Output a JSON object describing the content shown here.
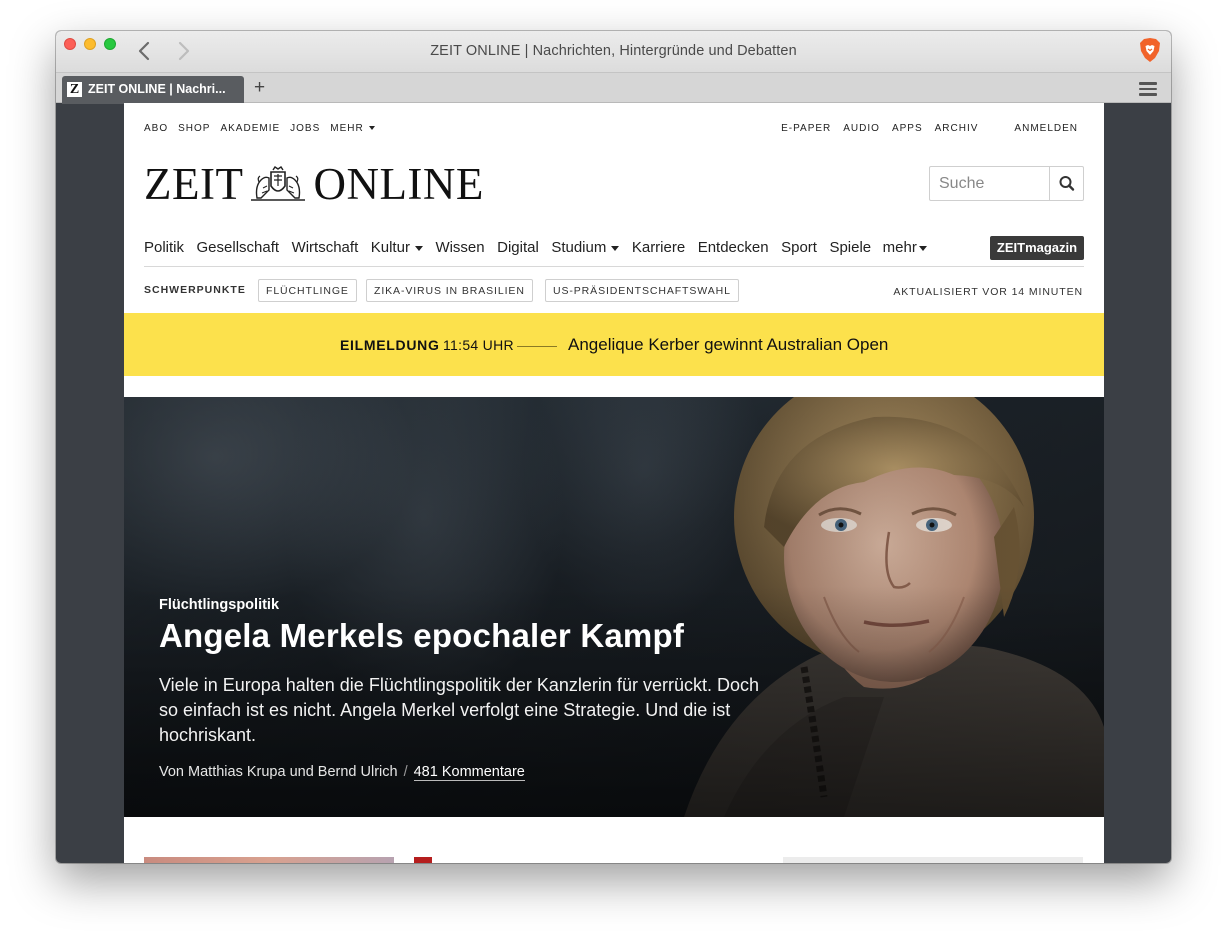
{
  "browser": {
    "window_title": "ZEIT ONLINE | Nachrichten, Hintergründe und Debatten",
    "tab_title": "ZEIT ONLINE | Nachri...",
    "new_tab": "+",
    "favicon": "Z"
  },
  "meta_nav": {
    "left": [
      "ABO",
      "SHOP",
      "AKADEMIE",
      "JOBS",
      "MEHR"
    ],
    "right": [
      "E-PAPER",
      "AUDIO",
      "APPS",
      "ARCHIV"
    ],
    "login": "ANMELDEN"
  },
  "logo": {
    "left": "ZEIT",
    "right": "ONLINE"
  },
  "search": {
    "placeholder": "Suche"
  },
  "main_nav": {
    "items": [
      "Politik",
      "Gesellschaft",
      "Wirtschaft",
      "Kultur",
      "Wissen",
      "Digital",
      "Studium",
      "Karriere",
      "Entdecken",
      "Sport",
      "Spiele",
      "mehr"
    ],
    "magazine": "ZEITmagazin"
  },
  "topics": {
    "label": "SCHWERPUNKTE",
    "items": [
      "FLÜCHTLINGE",
      "ZIKA-VIRUS IN BRASILIEN",
      "US-PRÄSIDENTSCHAFTSWAHL"
    ],
    "updated": "AKTUALISIERT VOR 14 MINUTEN"
  },
  "breaking": {
    "label": "EILMELDUNG",
    "time": "11:54 UHR",
    "text": "Angelique Kerber gewinnt Australian Open"
  },
  "hero": {
    "kicker": "Flüchtlingspolitik",
    "title": "Angela Merkels epochaler Kampf",
    "teaser": "Viele in Europa halten die Flüchtlingspolitik der Kanzlerin für verrückt. Doch so einfach ist es nicht. Angela Merkel verfolgt eine Strategie. Und die ist hochriskant.",
    "author": "Von Matthias Krupa und Bernd Ulrich",
    "separator": "/",
    "comments": "481 Kommentare"
  },
  "colors": {
    "breaking_bg": "#fce14c",
    "window_frame": "#3b3f45",
    "tab_active": "#595c60",
    "magazine_bg": "#3a3a3a"
  },
  "icons": [
    "back-arrow-icon",
    "forward-arrow-icon",
    "brave-lion-icon",
    "hamburger-menu-icon",
    "search-icon",
    "caret-down-icon",
    "crest-logo-icon"
  ]
}
